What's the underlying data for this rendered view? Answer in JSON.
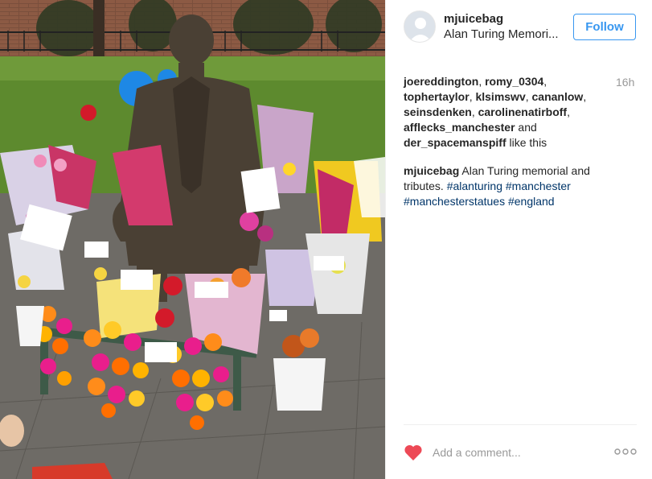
{
  "post": {
    "username": "mjuicebag",
    "location": "Alan Turing Memori...",
    "follow_label": "Follow",
    "timestamp": "16h",
    "photo_description_icon": "memorial-photo"
  },
  "likes": {
    "users": [
      "joereddington",
      "romy_0304",
      "tophertaylor",
      "klsimswv",
      "cananlow",
      "seinsdenken",
      "carolinenatirboff",
      "afflecks_manchester",
      "der_spacemanspiff"
    ],
    "and_text": "and",
    "suffix": "like this"
  },
  "caption": {
    "username": "mjuicebag",
    "text": "Alan Turing memorial and tributes.",
    "hashtags": [
      "#alanturing",
      "#manchester",
      "#manchesterstatues",
      "#england"
    ]
  },
  "comment": {
    "placeholder": "Add a comment...",
    "liked": true
  },
  "colors": {
    "accent": "#3897f0",
    "heart": "#ed4956",
    "hashtag": "#003569",
    "muted": "#999999"
  },
  "icons": {
    "like": "heart-icon",
    "more": "more-options-icon",
    "avatar": "avatar-placeholder-icon"
  }
}
